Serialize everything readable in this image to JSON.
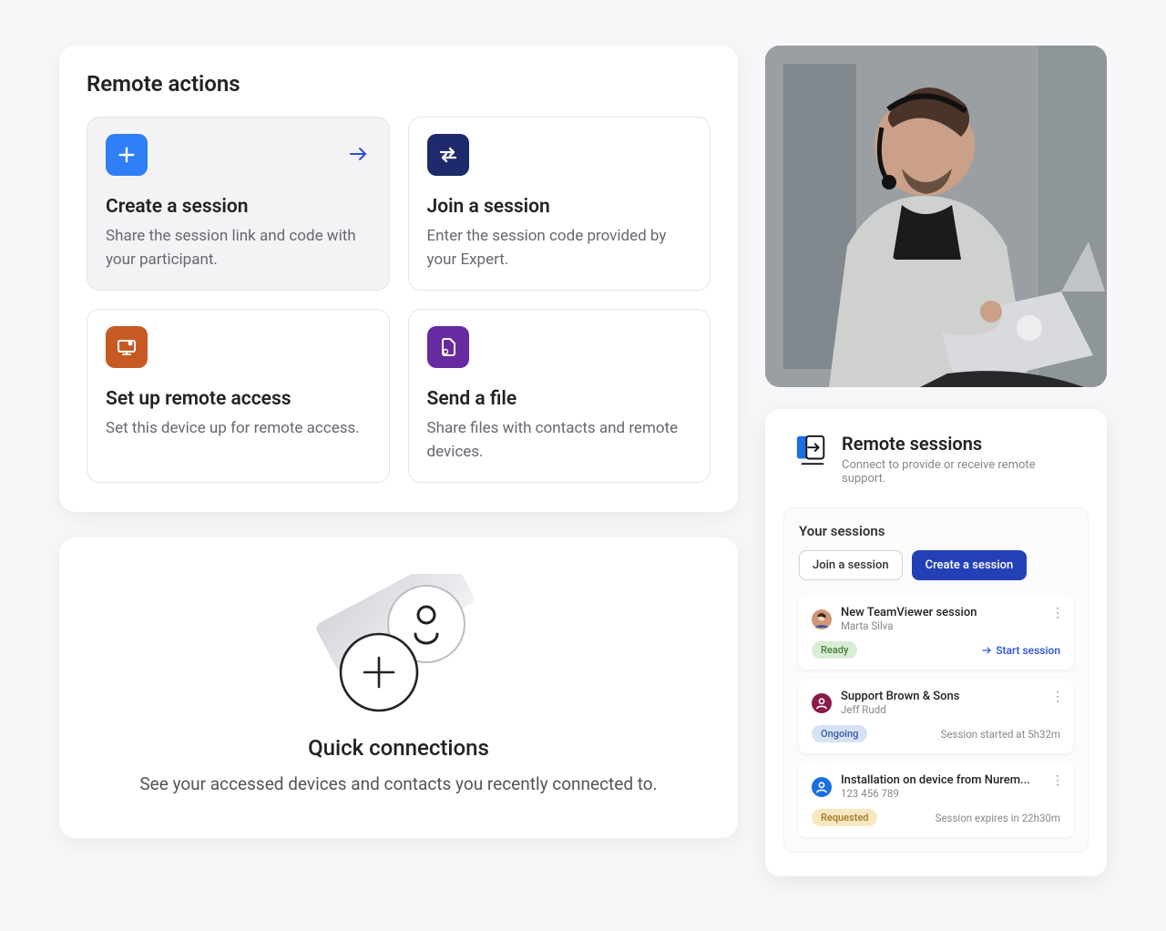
{
  "remote_actions": {
    "title": "Remote actions",
    "create": {
      "title": "Create a session",
      "desc": "Share the session link and code with your participant."
    },
    "join": {
      "title": "Join a session",
      "desc": "Enter the session code provided by your Expert."
    },
    "setup": {
      "title": "Set up remote access",
      "desc": "Set this device up for remote access."
    },
    "send": {
      "title": "Send a file",
      "desc": "Share files with contacts and remote devices."
    }
  },
  "quick": {
    "title": "Quick connections",
    "sub": "See your accessed devices and contacts you recently connected to."
  },
  "sessions_panel": {
    "title": "Remote sessions",
    "sub": "Connect to provide or receive remote support.",
    "box_title": "Your sessions",
    "tab_join": "Join a session",
    "tab_create": "Create a session"
  },
  "sessions": [
    {
      "title": "New TeamViewer session",
      "sub": "Marta Silva",
      "status": "Ready",
      "status_kind": "ready",
      "meta": "Start session",
      "meta_kind": "link",
      "avatar_kind": "photo"
    },
    {
      "title": "Support Brown & Sons",
      "sub": "Jeff Rudd",
      "status": "Ongoing",
      "status_kind": "ongoing",
      "meta": "Session started at 5h32m",
      "meta_kind": "text",
      "avatar_kind": "maroon"
    },
    {
      "title": "Installation on device from Nurem...",
      "sub": "123 456 789",
      "status": "Requested",
      "status_kind": "requested",
      "meta": "Session expires in 22h30m",
      "meta_kind": "text",
      "avatar_kind": "blue"
    }
  ],
  "colors": {
    "blue": "#2f7ef6",
    "navy": "#1e2a6b",
    "orange": "#c75a24",
    "purple": "#672aa0"
  }
}
